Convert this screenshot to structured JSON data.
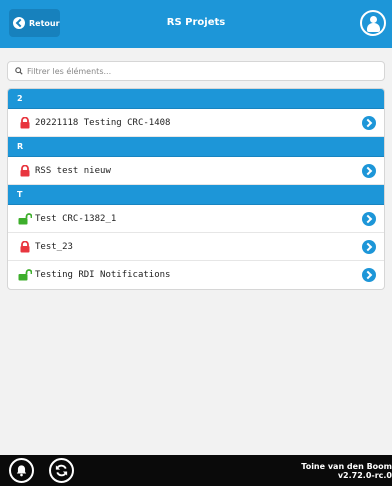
{
  "header": {
    "back_label": "Retour",
    "title": "RS Projets",
    "user_icon": "user-icon"
  },
  "search": {
    "placeholder": "Filtrer les éléments..."
  },
  "groups": [
    {
      "letter": "2",
      "items": [
        {
          "label": "20221118 Testing CRC-1408",
          "locked": true
        }
      ]
    },
    {
      "letter": "R",
      "items": [
        {
          "label": "RSS test nieuw",
          "locked": true
        }
      ]
    },
    {
      "letter": "T",
      "items": [
        {
          "label": "Test CRC-1382_1",
          "locked": false
        },
        {
          "label": "Test_23",
          "locked": true
        },
        {
          "label": "Testing RDI Notifications",
          "locked": false
        }
      ]
    }
  ],
  "footer": {
    "user_name": "Toine van den Boom",
    "version": "v2.72.0-rc.0"
  },
  "colors": {
    "primary": "#1d96d8",
    "lock_closed": "#e8363f",
    "lock_open": "#3dae2b"
  }
}
